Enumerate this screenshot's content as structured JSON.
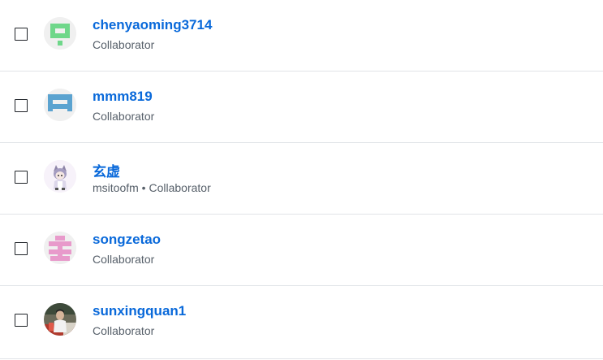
{
  "collaborators": [
    {
      "name": "chenyaoming3714",
      "subtitle": "Collaborator",
      "avatar": "identicon-green",
      "color": "#6fd78a"
    },
    {
      "name": "mmm819",
      "subtitle": "Collaborator",
      "avatar": "identicon-blue",
      "color": "#5ba3d0"
    },
    {
      "name": "玄虚",
      "subtitle": "msitoofm • Collaborator",
      "avatar": "anime-character-avatar",
      "color": "#c9b8e6"
    },
    {
      "name": "songzetao",
      "subtitle": "Collaborator",
      "avatar": "identicon-pink",
      "color": "#e89acb"
    },
    {
      "name": "sunxingquan1",
      "subtitle": "Collaborator",
      "avatar": "photo-avatar",
      "color": "#b03a2e"
    }
  ]
}
